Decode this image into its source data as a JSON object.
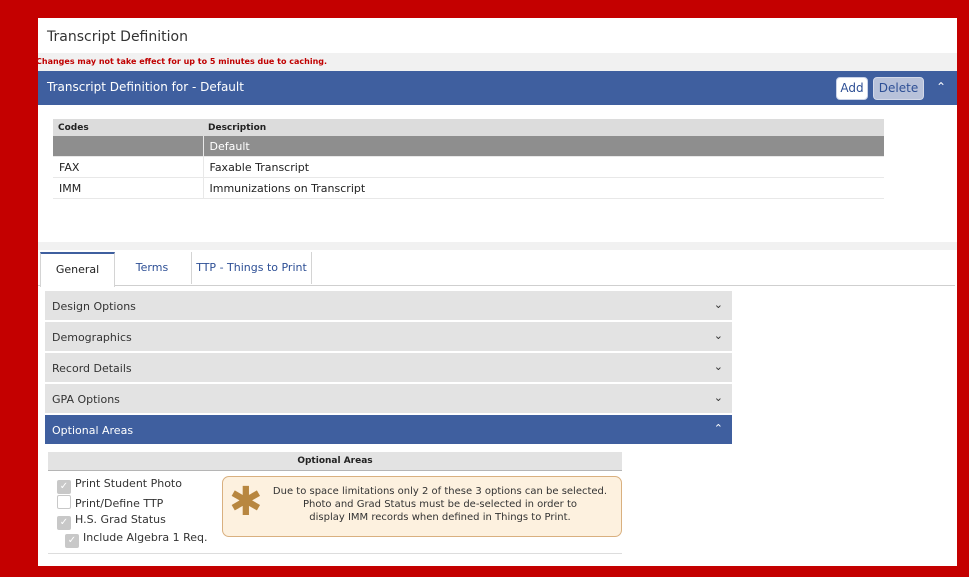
{
  "page": {
    "title": "Transcript Definition",
    "warning": "Changes may not take effect for up to 5 minutes due to caching."
  },
  "panel": {
    "title": "Transcript Definition for - Default",
    "add_label": "Add",
    "delete_label": "Delete",
    "collapse_icon": "chevron-up-icon"
  },
  "codes_table": {
    "headers": [
      "Codes",
      "Description"
    ],
    "rows": [
      {
        "code": "",
        "description": "Default",
        "selected": true
      },
      {
        "code": "FAX",
        "description": "Faxable Transcript",
        "selected": false
      },
      {
        "code": "IMM",
        "description": "Immunizations on Transcript",
        "selected": false
      }
    ]
  },
  "tabs": [
    {
      "label": "General",
      "active": true
    },
    {
      "label": "Terms",
      "active": false
    },
    {
      "label": "TTP - Things to Print",
      "active": false
    }
  ],
  "accordion": [
    {
      "label": "Design Options",
      "open": false
    },
    {
      "label": "Demographics",
      "open": false
    },
    {
      "label": "Record Details",
      "open": false
    },
    {
      "label": "GPA Options",
      "open": false
    },
    {
      "label": "Optional Areas",
      "open": true
    }
  ],
  "optional_areas": {
    "header": "Optional Areas",
    "checkboxes": [
      {
        "label": "Print Student Photo",
        "checked": true
      },
      {
        "label": "Print/Define TTP",
        "checked": false
      },
      {
        "label": "H.S. Grad Status",
        "checked": true
      },
      {
        "label": "Include Algebra 1 Req.",
        "checked": true
      }
    ],
    "note_lines": [
      "Due to space limitations only 2 of these 3 options can be selected.",
      "Photo and Grad Status must be de-selected in order to",
      "display IMM records when defined in Things to Print."
    ]
  },
  "colors": {
    "accent": "#3f5f9f",
    "frame": "#c40000",
    "warning": "#c00000",
    "note_bg": "#fdf1df"
  }
}
